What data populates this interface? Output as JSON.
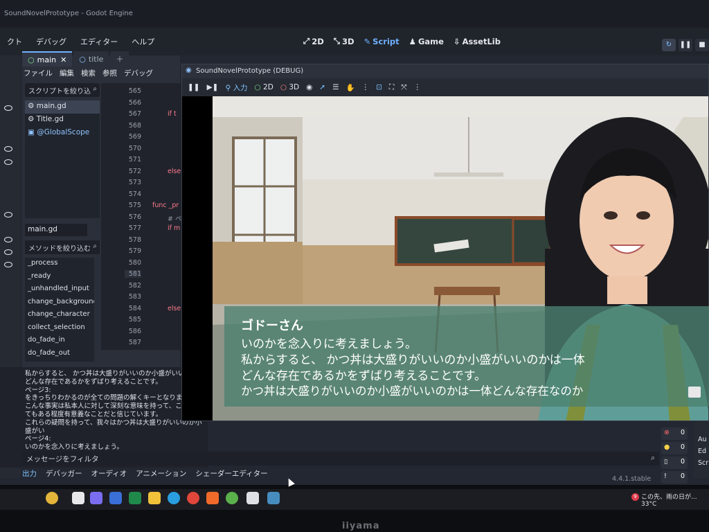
{
  "window": {
    "title": "SoundNovelPrototype - Godot Engine"
  },
  "menu": {
    "items": [
      "クト",
      "デバッグ",
      "エディター",
      "ヘルプ"
    ]
  },
  "modes": [
    {
      "label": "2D",
      "icon": "2d-icon"
    },
    {
      "label": "3D",
      "icon": "3d-icon"
    },
    {
      "label": "Script",
      "icon": "script-icon",
      "active": true
    },
    {
      "label": "Game",
      "icon": "game-icon"
    },
    {
      "label": "AssetLib",
      "icon": "assetlib-icon"
    }
  ],
  "script_tabs": [
    {
      "label": "main",
      "active": true
    },
    {
      "label": "title"
    }
  ],
  "script_menu": [
    "ファイル",
    "編集",
    "検索",
    "参照",
    "デバッグ"
  ],
  "script_filter_placeholder": "スクリプトを絞り込",
  "scripts": [
    "main.gd",
    "Title.gd",
    "@GlobalScope"
  ],
  "current_file": "main.gd",
  "method_filter_placeholder": "メソッドを絞り込む",
  "methods": [
    "_process",
    "_ready",
    "_unhandled_input",
    "change_background",
    "change_character",
    "collect_selection",
    "do_fade_in",
    "do_fade_out"
  ],
  "line_numbers": [
    "565",
    "566",
    "567",
    "568",
    "569",
    "570",
    "571",
    "572",
    "573",
    "574",
    "575",
    "576",
    "577",
    "578",
    "579",
    "580",
    "581",
    "582",
    "583",
    "584",
    "585",
    "586",
    "587"
  ],
  "code_fragments": {
    "567": "if t",
    "572": "else",
    "575": "func _pr",
    "576": "# ペ",
    "577": "if m",
    "584": "else"
  },
  "output_lines": [
    "私からすると、 かつ丼は大盛りがいいのか小盛がいいのかは",
    "どんな存在であるかをずばり考えることです。",
    "ページ3:",
    "をきっちりわかるのが全ての問題の解くキーとなります。",
    "こんな事実は私本人に対して深刻な意味を持って、この世",
    "てもある程度有意義なことだと信じています。",
    "これらの疑問を持って、我々はかつ丼は大盛りがいいのか小盛がい",
    "ページ4:",
    "いのかを念入りに考えましょう。"
  ],
  "message_filter_placeholder": "メッセージをフィルタ",
  "bottom_tabs": [
    "出力",
    "デバッガー",
    "オーディオ",
    "アニメーション",
    "シェーダーエディター"
  ],
  "version": "4.4.1.stable",
  "counters": [
    "0",
    "0",
    "0",
    "0"
  ],
  "right_pane": [
    "Au",
    "Ed",
    "Scri"
  ],
  "game_window": {
    "title": "SoundNovelPrototype (DEBUG)",
    "toolbar": {
      "input": "入力",
      "d2": "2D",
      "d3": "3D"
    }
  },
  "dialog": {
    "speaker": "ゴドーさん",
    "lines": [
      "いのかを念入りに考えましょう。",
      "私からすると、 かつ丼は大盛りがいいのか小盛がいいのかは一体",
      "どんな存在であるかをずばり考えることです。",
      "かつ丼は大盛りがいいのか小盛がいいのかは一体どんな存在なのか"
    ]
  },
  "taskbar": {
    "weather_text": "この先、雨の日が...",
    "temperature": "33°C",
    "badge": "9"
  },
  "monitor_brand": "iiyama"
}
